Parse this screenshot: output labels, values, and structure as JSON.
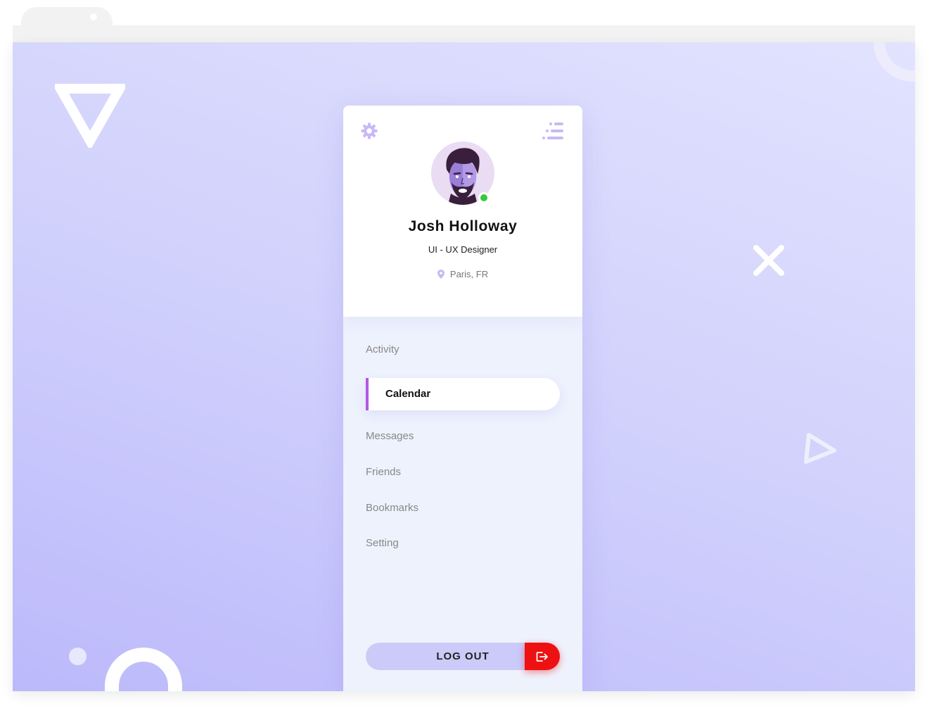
{
  "profile": {
    "name": "Josh Holloway",
    "role": "UI - UX Designer",
    "location": "Paris, FR",
    "status": "online"
  },
  "nav": {
    "items": [
      {
        "label": "Activity",
        "active": false
      },
      {
        "label": "Calendar",
        "active": true
      },
      {
        "label": "Messages",
        "active": false
      },
      {
        "label": "Friends",
        "active": false
      },
      {
        "label": "Bookmarks",
        "active": false
      },
      {
        "label": "Setting",
        "active": false
      }
    ]
  },
  "logout": {
    "label": "LOG OUT"
  },
  "icons": {
    "settings": "gear-icon",
    "menu": "menu-icon",
    "location": "location-pin-icon",
    "logout": "logout-icon"
  },
  "colors": {
    "accent": "#b259e3",
    "logout": "#ee1111",
    "status_online": "#36c93d",
    "icon_tint": "#c9b8f5",
    "background_start": "#bcb9fb",
    "background_end": "#e2e3fe"
  }
}
